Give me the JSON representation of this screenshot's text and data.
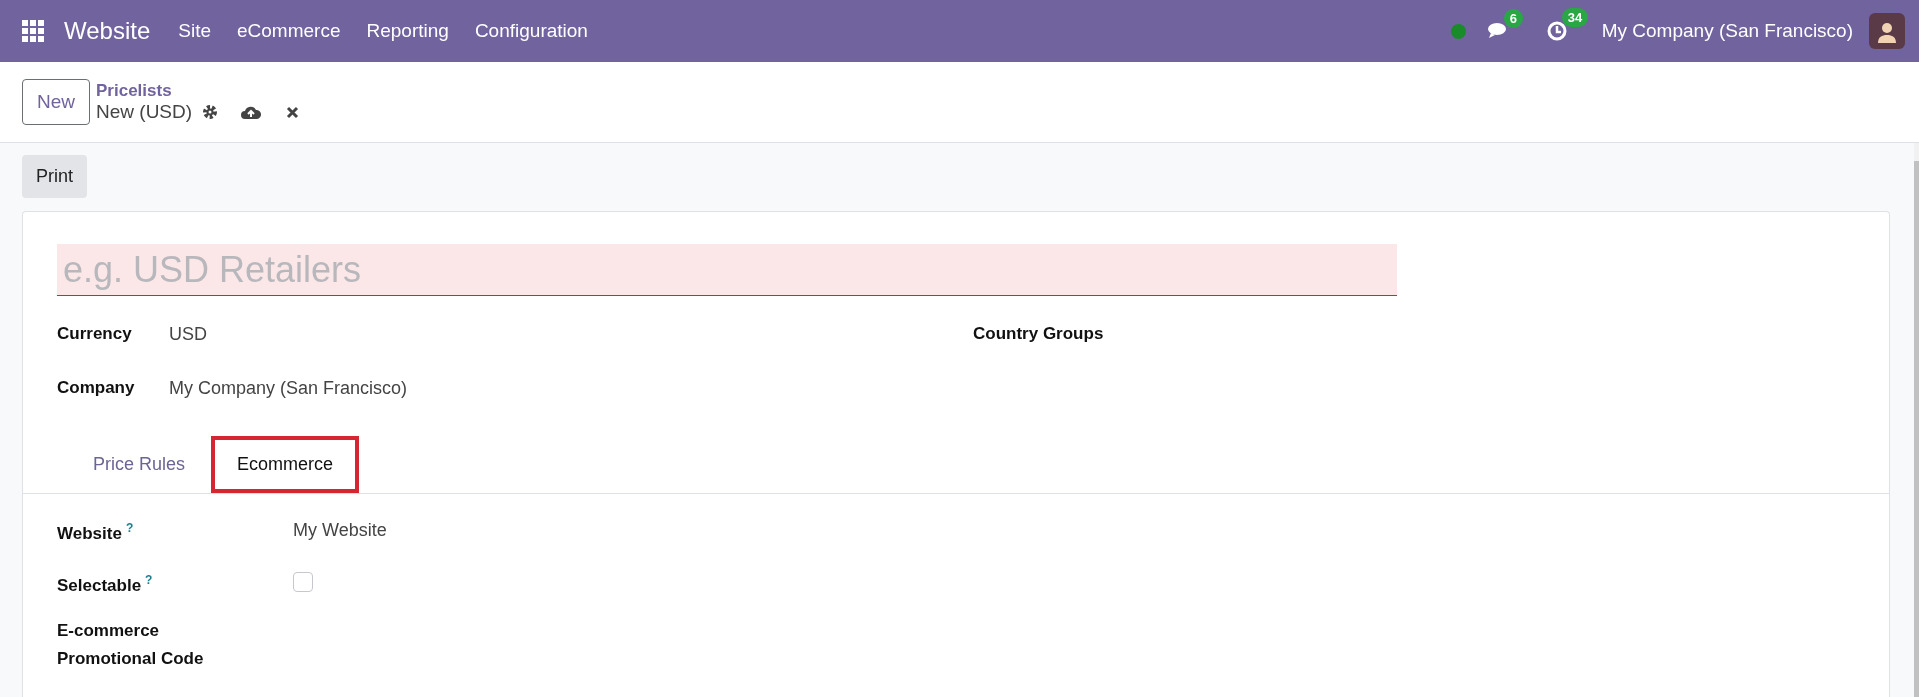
{
  "navbar": {
    "app_name": "Website",
    "menu": [
      "Site",
      "eCommerce",
      "Reporting",
      "Configuration"
    ],
    "online": true,
    "messages_count": "6",
    "activities_count": "34",
    "company": "My Company (San Francisco)"
  },
  "control_panel": {
    "new_button": "New",
    "breadcrumb": "Pricelists",
    "record": "New (USD)"
  },
  "print_button": "Print",
  "form": {
    "name_placeholder": "e.g. USD Retailers",
    "left_fields": [
      {
        "label": "Currency",
        "value": "USD"
      },
      {
        "label": "Company",
        "value": "My Company (San Francisco)"
      }
    ],
    "right_fields": [
      {
        "label": "Country Groups"
      }
    ],
    "tabs": [
      {
        "label": "Price Rules",
        "selected": false,
        "highlighted": false
      },
      {
        "label": "Ecommerce",
        "selected": true,
        "highlighted": true
      }
    ],
    "tab_fields": [
      {
        "kind": "text",
        "label": "Website",
        "help": "?",
        "value": "My Website"
      },
      {
        "kind": "checkbox",
        "label": "Selectable",
        "help": "?",
        "checked": false
      },
      {
        "kind": "text",
        "label": "E-commerce Promotional Code"
      }
    ]
  }
}
